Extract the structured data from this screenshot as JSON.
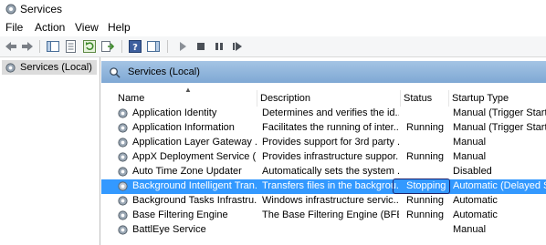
{
  "window": {
    "title": "Services"
  },
  "menu": [
    "File",
    "Action",
    "View",
    "Help"
  ],
  "toolbar": {
    "icons": [
      "back-arrow-icon",
      "forward-arrow-icon",
      "console-tree-icon",
      "properties-icon",
      "refresh-icon",
      "export-list-icon",
      "help-icon",
      "show-action-pane-icon",
      "start-service-icon",
      "stop-service-icon",
      "pause-service-icon",
      "restart-service-icon"
    ]
  },
  "tree": {
    "root_label": "Services (Local)"
  },
  "panel": {
    "title": "Services (Local)",
    "columns": {
      "name": "Name",
      "description": "Description",
      "status": "Status",
      "startup": "Startup Type"
    },
    "rows": [
      {
        "name": "Application Identity",
        "description": "Determines and verifies the id...",
        "status": "",
        "startup": "Manual (Trigger Start)"
      },
      {
        "name": "Application Information",
        "description": "Facilitates the running of inter...",
        "status": "Running",
        "startup": "Manual (Trigger Start)"
      },
      {
        "name": "Application Layer Gateway ...",
        "description": "Provides support for 3rd party ...",
        "status": "",
        "startup": "Manual"
      },
      {
        "name": "AppX Deployment Service (...",
        "description": "Provides infrastructure suppor...",
        "status": "Running",
        "startup": "Manual"
      },
      {
        "name": "Auto Time Zone Updater",
        "description": "Automatically sets the system ...",
        "status": "",
        "startup": "Disabled"
      },
      {
        "name": "Background Intelligent Tran...",
        "description": "Transfers files in the backgrou...",
        "status": "Stopping",
        "startup": "Automatic (Delayed S"
      },
      {
        "name": "Background Tasks Infrastru...",
        "description": "Windows infrastructure servic...",
        "status": "Running",
        "startup": "Automatic"
      },
      {
        "name": "Base Filtering Engine",
        "description": "The Base Filtering Engine (BFE...",
        "status": "Running",
        "startup": "Automatic"
      },
      {
        "name": "BattlEye Service",
        "description": "",
        "status": "",
        "startup": "Manual"
      }
    ]
  },
  "colors": {
    "selection": "#3399ff",
    "banner": "#8fb4dc",
    "status_highlight_border": "#202068"
  }
}
